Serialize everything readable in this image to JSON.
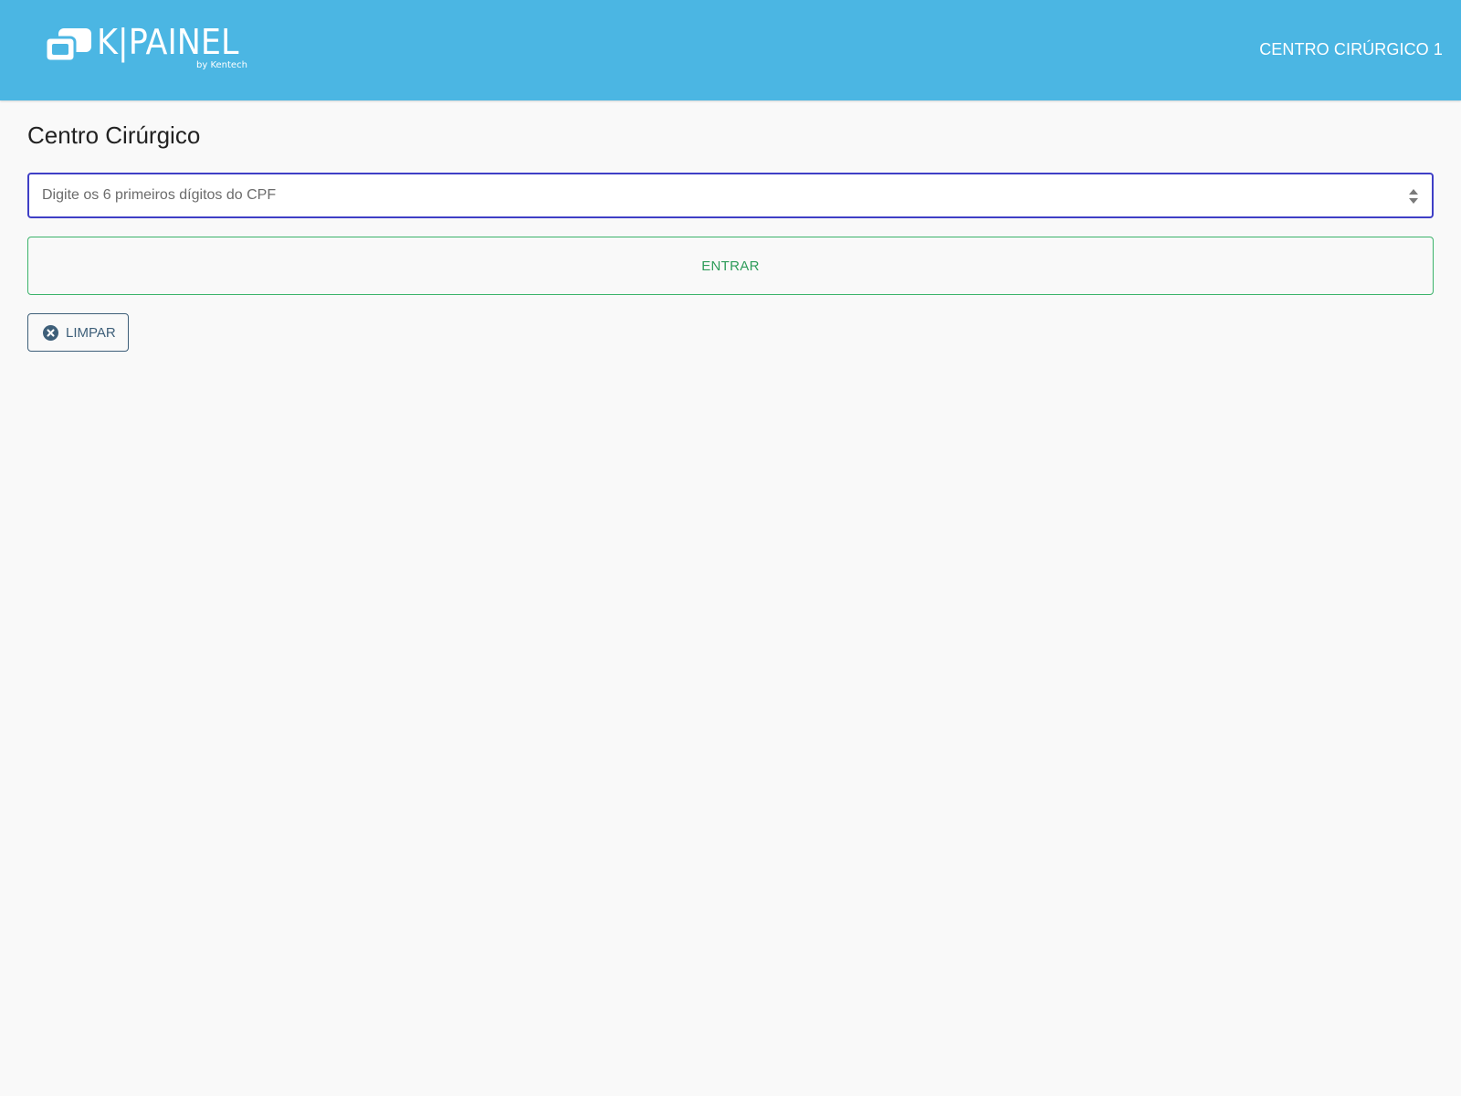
{
  "header": {
    "logo": {
      "wordmark": "K|PAINEL",
      "byline": "by Kentech",
      "icon": "chat-bubbles-icon"
    },
    "location_label": "CENTRO CIRÚRGICO 1"
  },
  "main": {
    "title": "Centro Cirúrgico",
    "cpf_input": {
      "value": "",
      "placeholder": "Digite os 6 primeiros dígitos do CPF",
      "spinner_icon": "number-spinner-icon"
    },
    "enter_button": {
      "label": "ENTRAR"
    },
    "clear_button": {
      "label": "LIMPAR",
      "icon": "x-circle-icon"
    }
  },
  "colors": {
    "header_bg": "#4bb6e3",
    "input_focus_border": "#3f3fc6",
    "enter_accent": "#2e9c5a",
    "clear_accent": "#3e5f79",
    "page_bg": "#f9f9f9"
  }
}
